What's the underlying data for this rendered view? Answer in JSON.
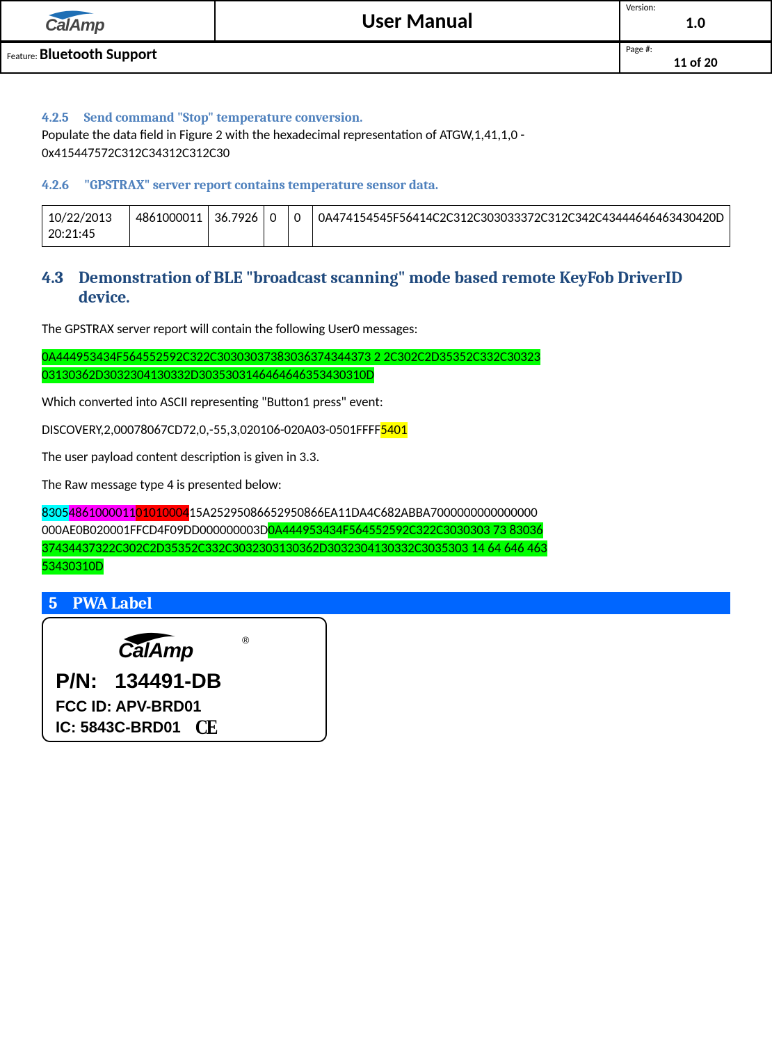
{
  "header": {
    "logo_text": "CalAmp",
    "title": "User Manual",
    "version_label": "Version:",
    "version": "1.0",
    "feature_label": "Feature:",
    "feature": "Bluetooth Support",
    "page_label": "Page #:",
    "page": "11 of 20"
  },
  "sec425": {
    "num": "4.2.5",
    "title": "Send command \"Stop\" temperature conversion.",
    "body_a": "Populate the data field in Figure 2 with the hexadecimal representation of  ATGW,1,41,1,0 -",
    "body_b": "0x415447572C312C34312C312C30"
  },
  "sec426": {
    "num": "4.2.6",
    "title": "\"GPSTRAX\" server report contains temperature sensor data."
  },
  "table": {
    "c0": "10/22/2013 20:21:45",
    "c1": "4861000011",
    "c2": "36.7926",
    "c3": "0",
    "c4": "0",
    "c5": "0A474154545F56414C2C312C303033372C312C342C43444646463430420D"
  },
  "sec43": {
    "num": "4.3",
    "title": "Demonstration of BLE \"broadcast scanning\" mode based remote KeyFob DriverID device."
  },
  "body": {
    "p1": "The GPSTRAX server report will contain the following User0 messages:",
    "hex1a": "0A444953434F564552592C322C30303037383036374344373 2 2C302C2D35352C332C30323",
    "hex1b": "03130362D3032304130332D3035303146464646353430310D",
    "p2": "Which converted into ASCII representing \"Button1 press\" event:",
    "p3a": "DISCOVERY,2,00078067CD72,0,-55,3,020106-020A03-0501FFFF",
    "p3b": "5401",
    "p4": "The user payload content description is given in 3.3.",
    "p5": "The Raw message type 4 is presented below:",
    "raw_cyan": "8305",
    "raw_mag": "4861000011",
    "raw_red": "01010004",
    "raw_plain_a": "15A25295086652950866EA11DA4C682ABBA7000000000000000",
    "raw_plain_b": "000AE0B020001FFCD4F09DD000000003D",
    "raw_green_a": "0A444953434F564552592C322C3030303 73 83036",
    "raw_green_b": "37434437322C302C2D35352C332C3032303130362D3032304130332C3035303 14 64 646 463",
    "raw_green_c": "53430310D"
  },
  "sec5": {
    "num": "5",
    "title": "PWA Label"
  },
  "label": {
    "logo_text": "CalAmp",
    "pn_label": "P/N:",
    "pn": "134491-DB",
    "fcc_label": "FCC ID:",
    "fcc": "APV-BRD01",
    "ic_label": "IC:",
    "ic": "5843C-BRD01",
    "ce": "CE"
  }
}
